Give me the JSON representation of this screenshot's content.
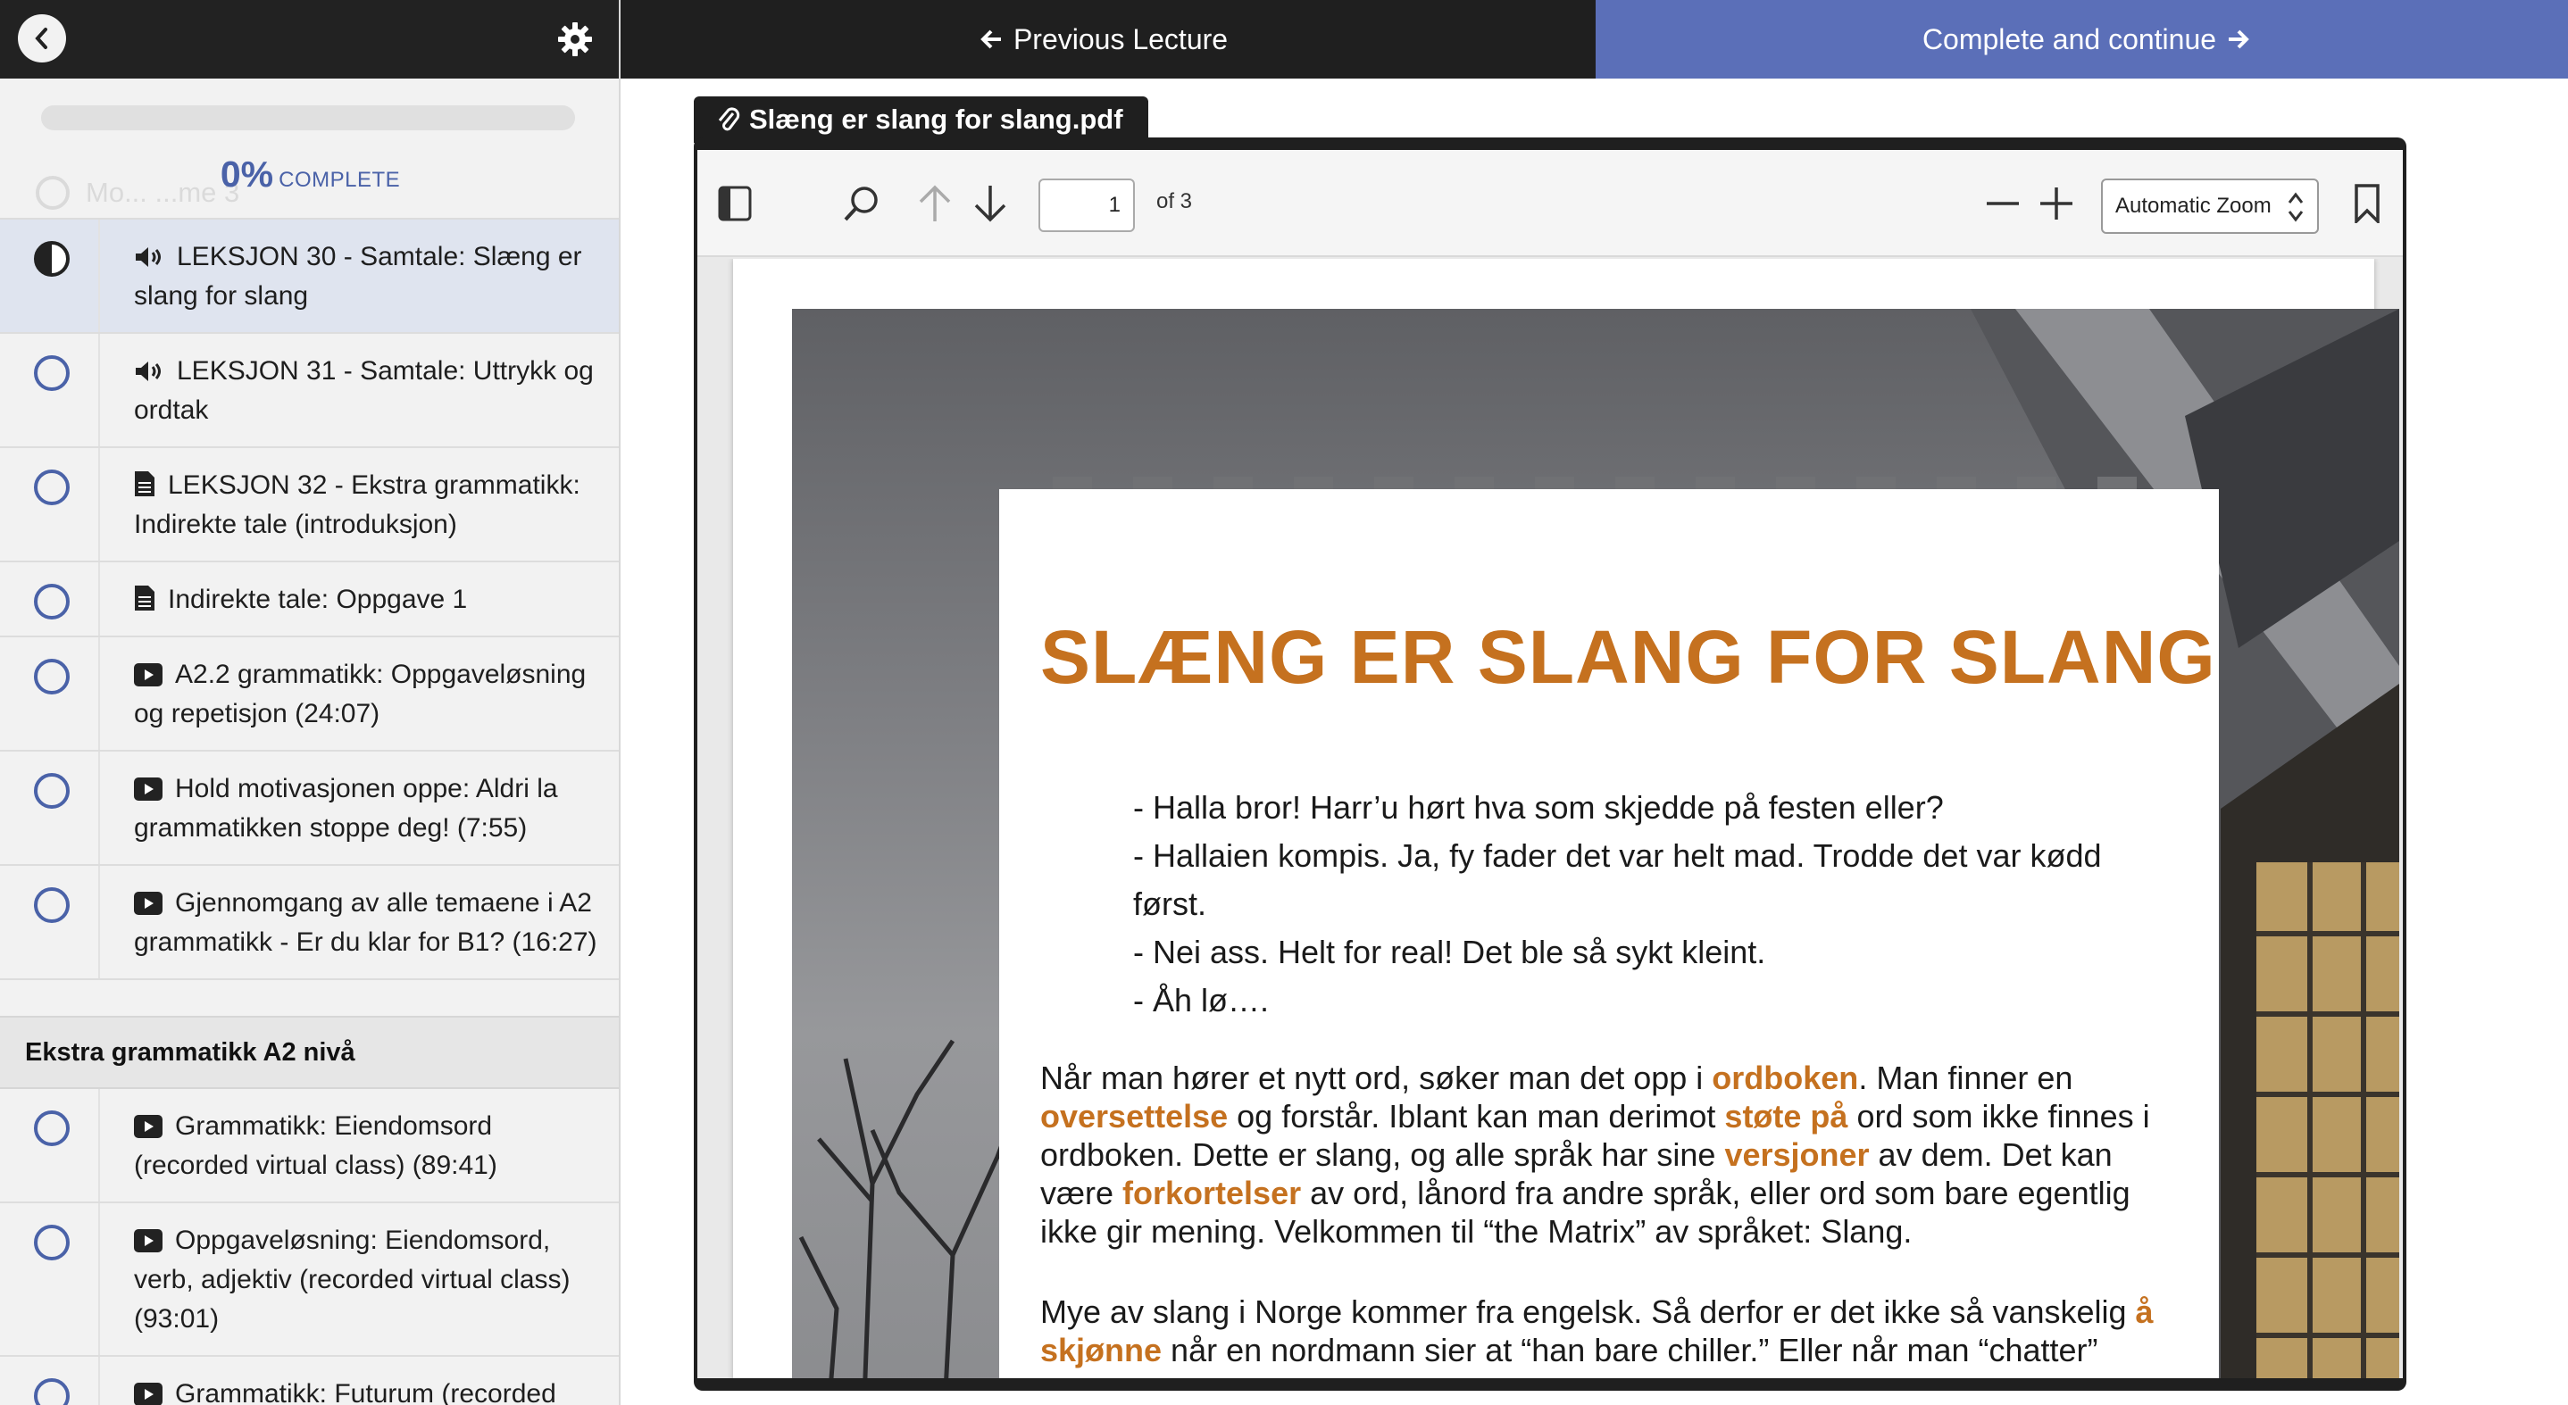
{
  "sidebar": {
    "progress": {
      "percent": "0%",
      "label": "COMPLETE",
      "value": 0
    },
    "ghost_item": "Mo... ...me 3",
    "lectures": [
      {
        "icon": "audio",
        "title": "LEKSJON 30 - Samtale: Slæng er slang for slang",
        "active": true
      },
      {
        "icon": "audio",
        "title": "LEKSJON 31 - Samtale: Uttrykk og ordtak",
        "active": false
      },
      {
        "icon": "document",
        "title": "LEKSJON 32 - Ekstra grammatikk: Indirekte tale (introduksjon)",
        "active": false
      },
      {
        "icon": "document",
        "title": "Indirekte tale: Oppgave 1",
        "active": false
      },
      {
        "icon": "video",
        "title": "A2.2 grammatikk: Oppgaveløsning og repetisjon (24:07)",
        "active": false
      },
      {
        "icon": "video",
        "title": "Hold motivasjonen oppe: Aldri la grammatikken stoppe deg! (7:55)",
        "active": false
      },
      {
        "icon": "video",
        "title": "Gjennomgang av alle temaene i A2 grammatikk - Er du klar for B1? (16:27)",
        "active": false
      }
    ],
    "section2": {
      "title": "Ekstra grammatikk A2 nivå",
      "lectures": [
        {
          "icon": "video",
          "title": "Grammatikk: Eiendomsord (recorded virtual class) (89:41)"
        },
        {
          "icon": "video",
          "title": "Oppgaveløsning: Eiendomsord, verb, adjektiv (recorded virtual class) (93:01)"
        },
        {
          "icon": "video",
          "title": "Grammatikk: Futurum (recorded"
        }
      ]
    }
  },
  "nav": {
    "previous_label": "Previous Lecture",
    "next_label": "Complete and continue"
  },
  "attachment": {
    "filename": "Slæng er slang for slang.pdf"
  },
  "pdf_toolbar": {
    "page_value": "1",
    "page_count_label": "of 3",
    "zoom_label": "Automatic Zoom"
  },
  "pdf_content": {
    "title": "SLÆNG ER SLANG FOR SLANG",
    "dialogue": [
      "- Halla bror! Harr’u hørt hva som skjedde på festen eller?",
      "- Hallaien kompis. Ja, fy fader det var helt mad. Trodde det var kødd først.",
      "- Nei ass. Helt for real! Det ble så sykt kleint.",
      "- Åh lø…."
    ],
    "p1": {
      "a": "Når man hører et nytt ord, søker man det opp i ",
      "h1": "ordboken",
      "b": ". Man finner en ",
      "h2": "oversettelse",
      "c": " og forstår. Iblant kan man derimot ",
      "h3": "støte på",
      "d": " ord som ikke finnes i ordboken. Dette er slang, og alle språk har sine ",
      "h4": "versjoner",
      "e": " av dem. Det kan være ",
      "h5": "forkortelser",
      "f": " av ord, lånord fra andre språk, eller ord som bare egentlig ikke gir mening. Velkommen til “the Matrix” av språket: Slang."
    },
    "p2": {
      "a": "Mye av slang i Norge kommer fra engelsk. Så derfor er det ikke så vanskelig ",
      "h1": "å skjønne",
      "b": " når en nordmann sier at “han bare chiller.” Eller når man “chatter”"
    }
  },
  "colors": {
    "accent": "#5b6fb8",
    "progress_text": "#4a62a8",
    "pdf_highlight": "#c5711f",
    "dark_bar": "#1f1f1f"
  }
}
